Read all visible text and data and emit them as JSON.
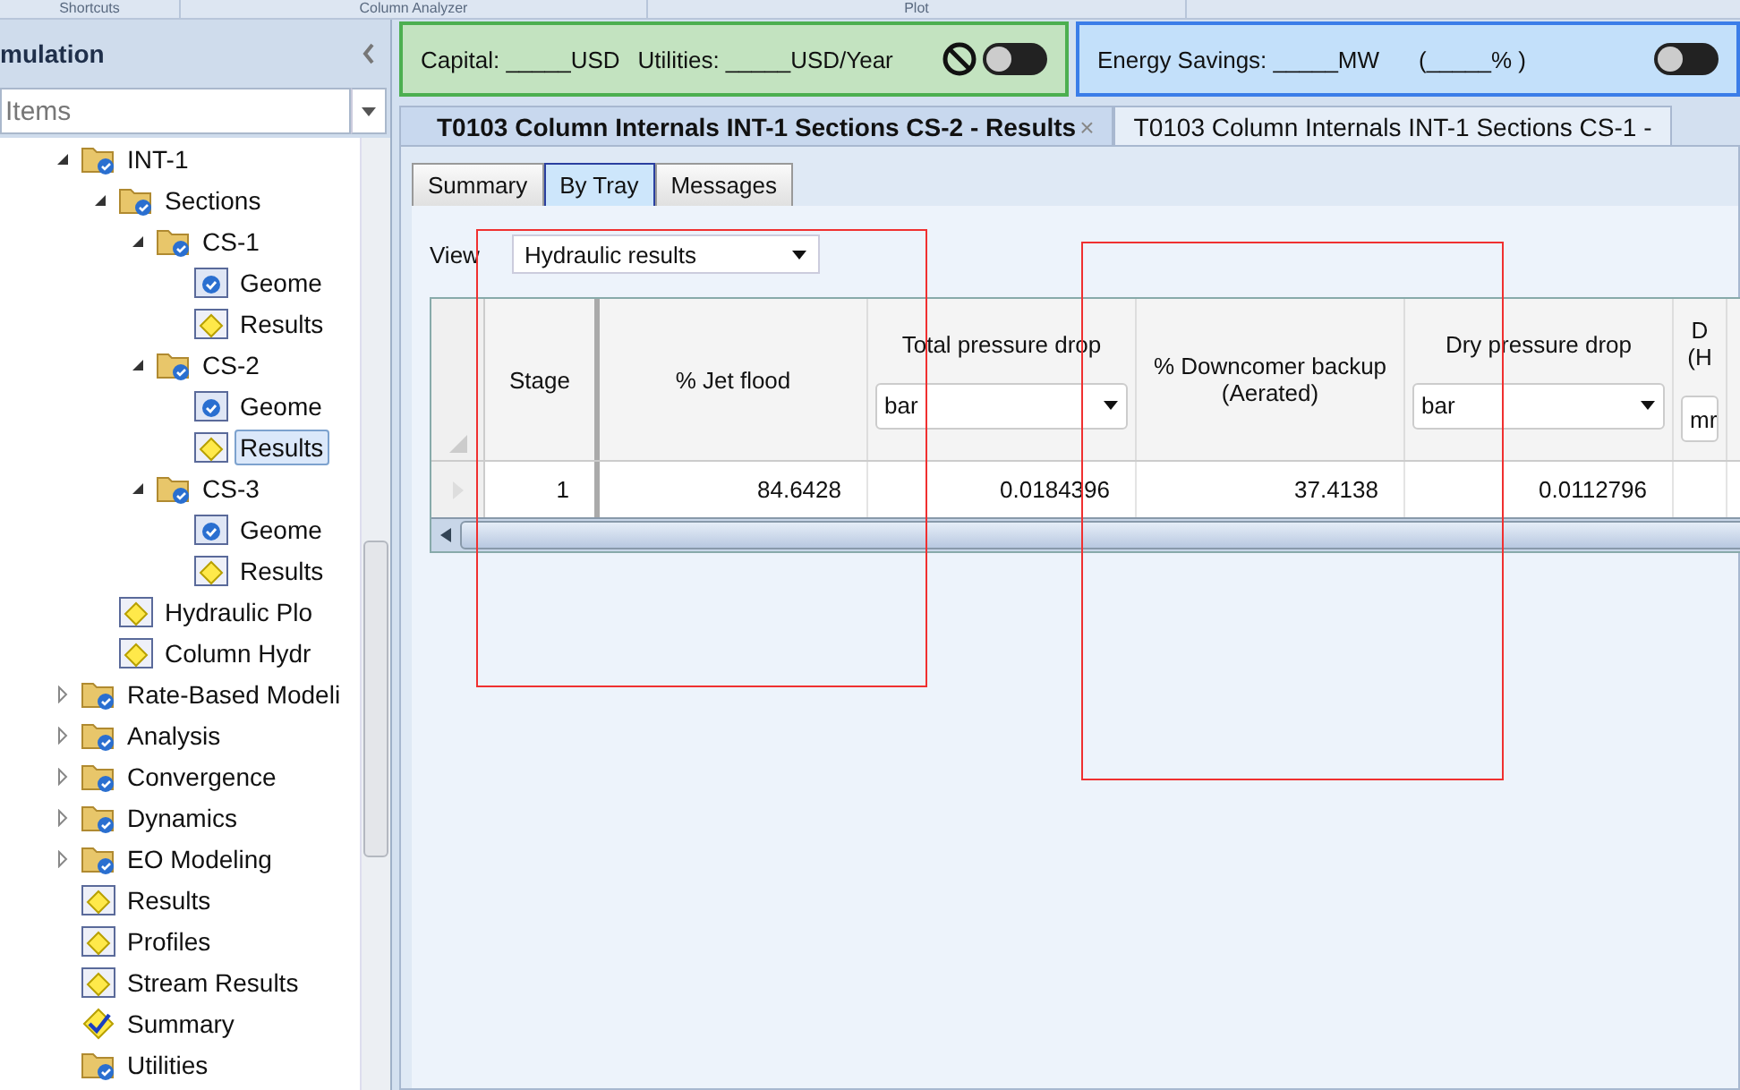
{
  "top_tabs": [
    "Shortcuts",
    "Column Analyzer",
    "Plot"
  ],
  "sidebar": {
    "title": "mulation",
    "filter": {
      "placeholder": "Items"
    },
    "tree": [
      {
        "label": "INT-1",
        "kind": "folder",
        "expanded": true,
        "selected": false,
        "children": [
          {
            "label": "Sections",
            "kind": "folder",
            "expanded": true,
            "selected": false,
            "children": [
              {
                "label": "CS-1",
                "kind": "folder",
                "expanded": true,
                "selected": false,
                "children": [
                  {
                    "label": "Geome",
                    "kind": "form",
                    "selected": false
                  },
                  {
                    "label": "Results",
                    "kind": "result",
                    "selected": false
                  }
                ]
              },
              {
                "label": "CS-2",
                "kind": "folder",
                "expanded": true,
                "selected": false,
                "children": [
                  {
                    "label": "Geome",
                    "kind": "form",
                    "selected": false
                  },
                  {
                    "label": "Results",
                    "kind": "result",
                    "selected": true
                  }
                ]
              },
              {
                "label": "CS-3",
                "kind": "folder",
                "expanded": true,
                "selected": false,
                "children": [
                  {
                    "label": "Geome",
                    "kind": "form",
                    "selected": false
                  },
                  {
                    "label": "Results",
                    "kind": "result",
                    "selected": false
                  }
                ]
              }
            ]
          },
          {
            "label": "Hydraulic Plo",
            "kind": "result",
            "selected": false
          },
          {
            "label": "Column Hydr",
            "kind": "result",
            "selected": false
          }
        ]
      },
      {
        "label": "Rate-Based Modeli",
        "kind": "folder",
        "expanded": false,
        "selected": false
      },
      {
        "label": "Analysis",
        "kind": "folder",
        "expanded": false,
        "selected": false
      },
      {
        "label": "Convergence",
        "kind": "folder",
        "expanded": false,
        "selected": false
      },
      {
        "label": "Dynamics",
        "kind": "folder",
        "expanded": false,
        "selected": false
      },
      {
        "label": "EO Modeling",
        "kind": "folder",
        "expanded": false,
        "selected": false
      },
      {
        "label": "Results",
        "kind": "result",
        "selected": false
      },
      {
        "label": "Profiles",
        "kind": "result",
        "selected": false
      },
      {
        "label": "Stream Results",
        "kind": "result",
        "selected": false
      },
      {
        "label": "Summary",
        "kind": "summary",
        "selected": false
      },
      {
        "label": "Utilities",
        "kind": "folder",
        "selected": false
      }
    ]
  },
  "cost_panel": {
    "capital": "Capital: _____USD",
    "utilities": "Utilities: _____USD/Year",
    "on": false
  },
  "energy_panel": {
    "savings": "Energy Savings: _____MW",
    "percent": "(_____% )",
    "on": false
  },
  "doc_tabs": [
    {
      "label": "T0103 Column Internals INT-1 Sections CS-2 - Results",
      "selected": true,
      "close": "×"
    },
    {
      "label": "T0103 Column Internals INT-1 Sections CS-1 -",
      "selected": false
    }
  ],
  "inner_tabs": [
    {
      "label": "Summary",
      "selected": false
    },
    {
      "label": "By Tray",
      "selected": true
    },
    {
      "label": "Messages",
      "selected": false
    }
  ],
  "view": {
    "label": "View",
    "value": "Hydraulic results"
  },
  "table": {
    "columns": [
      {
        "title": "Stage"
      },
      {
        "title": "% Jet flood"
      },
      {
        "title": "Total pressure drop",
        "unit": "bar"
      },
      {
        "title": "% Downcomer backup (Aerated)"
      },
      {
        "title": "Dry pressure drop",
        "unit": "bar"
      },
      {
        "title": "D (H",
        "unit": "mr"
      }
    ],
    "rows": [
      [
        "1",
        "84.6428",
        "0.0184396",
        "37.4138",
        "0.0112796",
        ""
      ]
    ]
  }
}
